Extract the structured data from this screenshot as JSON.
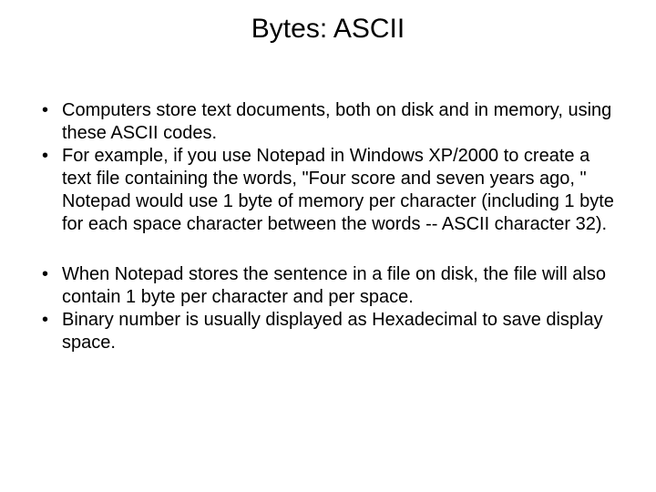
{
  "title": "Bytes: ASCII",
  "bullets": [
    "Computers store text documents, both on disk and in memory, using these ASCII codes.",
    "For example, if you use Notepad in Windows XP/2000 to create a text file containing the words, \"Four score and seven years ago, \" Notepad would use 1 byte of memory per character (including 1 byte for each space character between the words -- ASCII character 32).",
    "When Notepad stores the sentence in a file on disk, the file will also contain 1 byte per character and per space.",
    "Binary number is usually displayed as Hexadecimal to save display space."
  ]
}
